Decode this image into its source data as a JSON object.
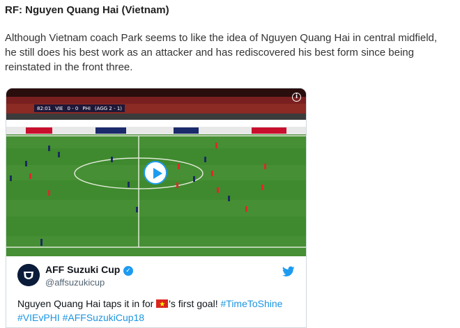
{
  "article": {
    "heading": "RF: Nguyen Quang Hai (Vietnam)",
    "paragraph": "Although Vietnam coach Park seems to like the idea of Nguyen Quang Hai in central midfield, he still does his best work as an attacker and has rediscovered his best form since being reinstated in the front three."
  },
  "video": {
    "match_time": "82:01",
    "home_team": "VIE",
    "score": "0 - 0",
    "away_team": "PHI",
    "aggregate": "(AGG 2 - 1)",
    "info_icon": "info-icon",
    "play_icon": "play-icon"
  },
  "tweet": {
    "author_name": "AFF Suzuki Cup",
    "handle": "@affsuzukicup",
    "text_before_flag": "Nguyen Quang Hai taps it in for ",
    "flag_icon": "vietnam-flag-icon",
    "text_after_flag": "'s first goal! ",
    "hashtag_1": "#TimeToShine",
    "hashtag_2": "#VIEvPHI",
    "hashtag_3": "#AFFSuzukiCup18",
    "verified_icon": "verified-icon",
    "brand_icon": "twitter-bird-icon"
  },
  "colors": {
    "link": "#1b95e0",
    "verified": "#1d9bf0",
    "pitch": "#3f8a2e"
  }
}
